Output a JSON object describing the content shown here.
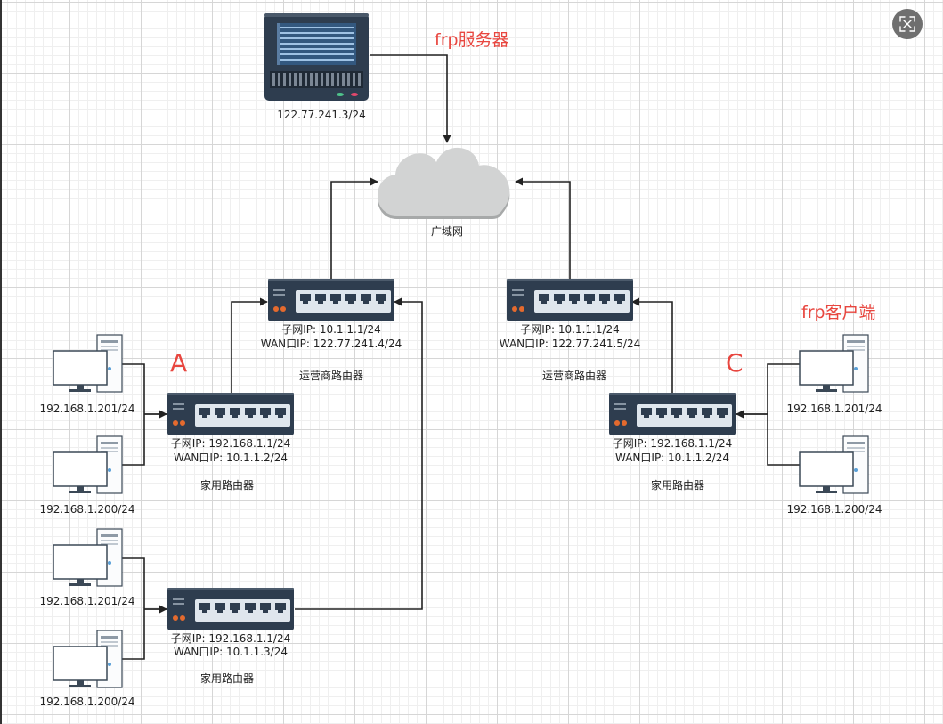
{
  "server": {
    "title": "frp服务器",
    "ip": "122.77.241.3/24"
  },
  "cloud": {
    "label": "广域网"
  },
  "carrier_router_left": {
    "subnet": "子网IP:  10.1.1.1/24",
    "wan": "WAN口IP:  122.77.241.4/24",
    "label": "运营商路由器"
  },
  "carrier_router_right": {
    "subnet": "子网IP:  10.1.1.1/24",
    "wan": "WAN口IP:  122.77.241.5/24",
    "label": "运营商路由器"
  },
  "home_router_a": {
    "subnet": "子网IP:  192.168.1.1/24",
    "wan": "WAN口IP:  10.1.1.2/24",
    "label": "家用路由器"
  },
  "home_router_b": {
    "subnet": "子网IP:  192.168.1.1/24",
    "wan": "WAN口IP:  10.1.1.3/24",
    "label": "家用路由器"
  },
  "home_router_c": {
    "subnet": "子网IP:  192.168.1.1/24",
    "wan": "WAN口IP:  10.1.1.2/24",
    "label": "家用路由器"
  },
  "group_labels": {
    "a": "A",
    "c": "C",
    "frp_client": "frp客户端"
  },
  "pcs": {
    "a1": "192.168.1.201/24",
    "a2": "192.168.1.200/24",
    "b1": "192.168.1.201/24",
    "b2": "192.168.1.200/24",
    "c1": "192.168.1.201/24",
    "c2": "192.168.1.200/24"
  },
  "colors": {
    "line": "#222222",
    "device": "#2e3d4f",
    "accent": "#e8463f",
    "cloud": "#cfd0d0"
  },
  "icons": {
    "exit": "exit-fullscreen-icon"
  }
}
